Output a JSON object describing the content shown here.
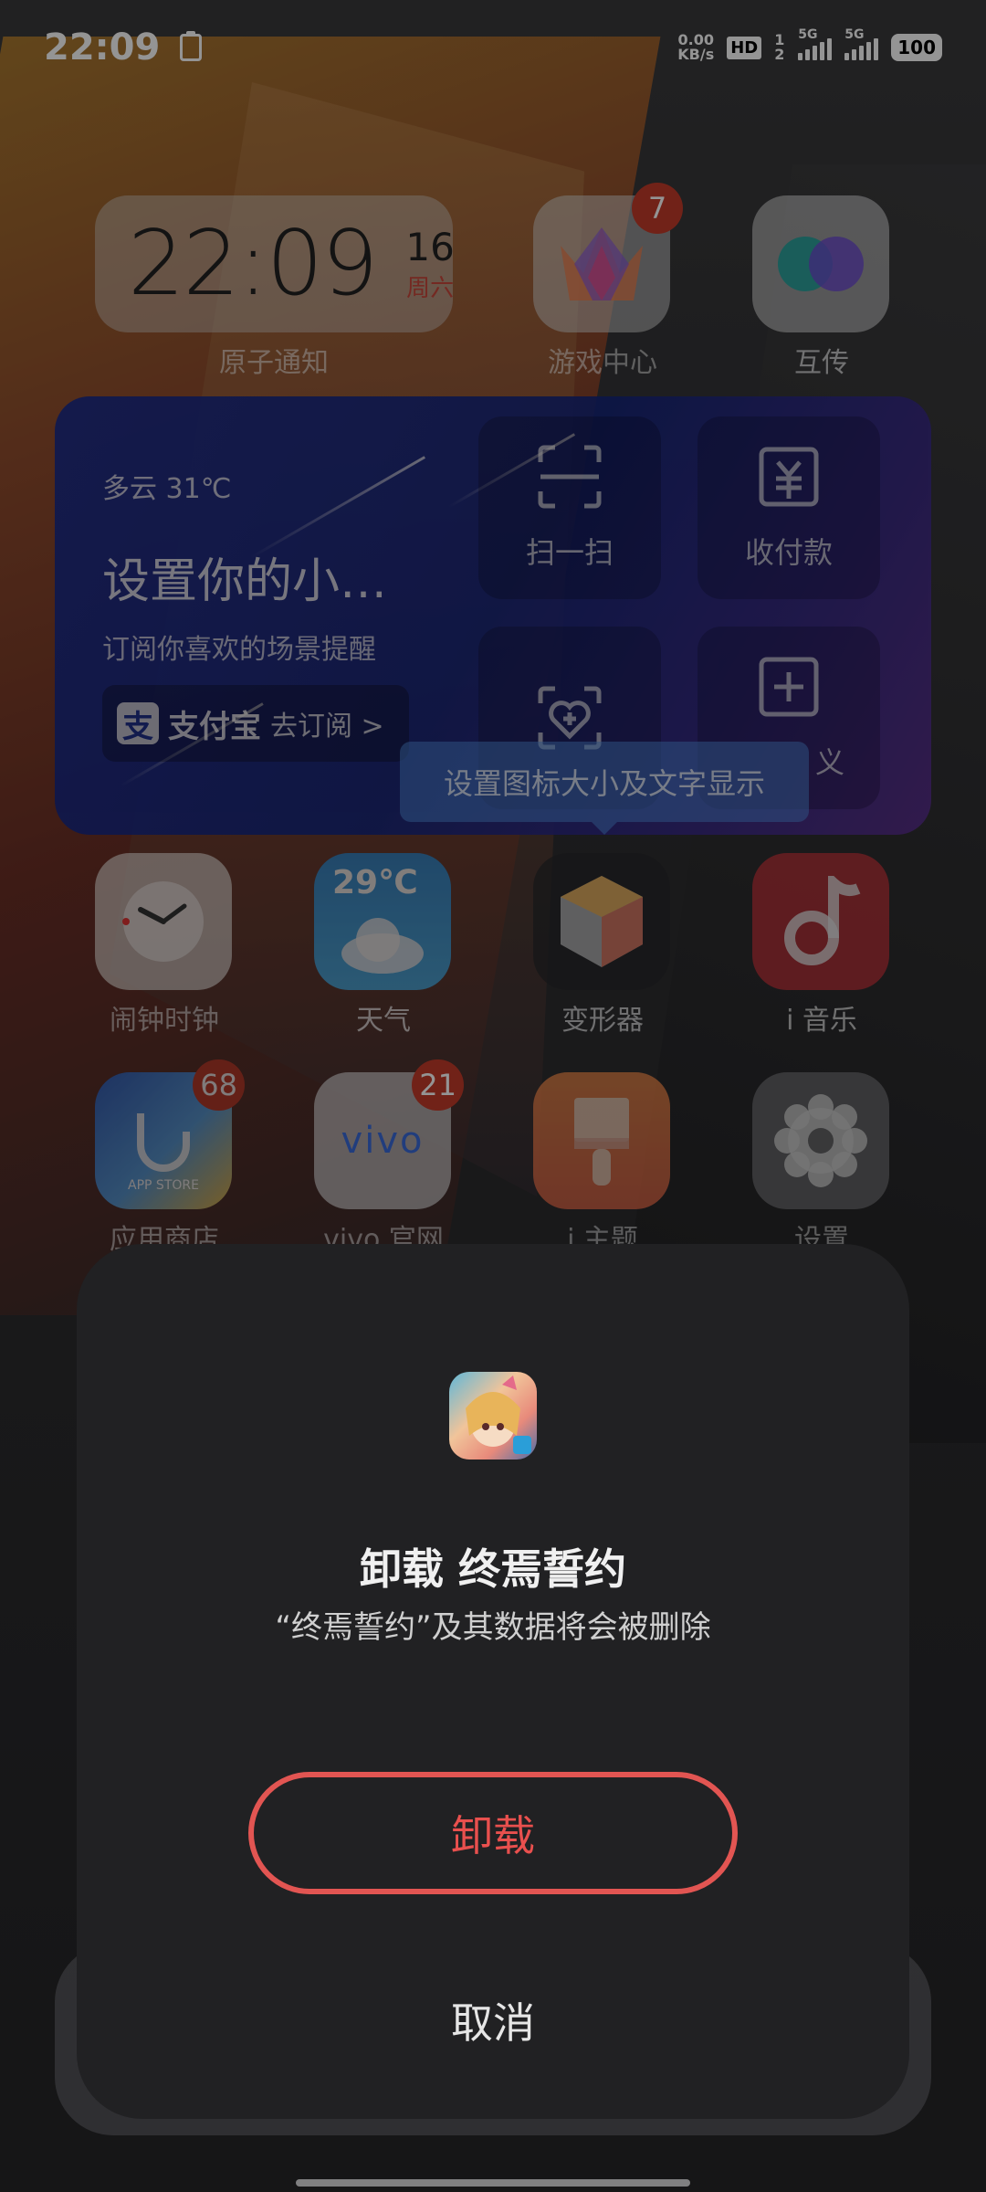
{
  "status_bar": {
    "time": "22:09",
    "net_speed_value": "0.00",
    "net_speed_unit": "KB/s",
    "hd": "HD",
    "sim1_label": "5G",
    "sim2_label": "5G",
    "sim_slot": "1 2",
    "battery": "100"
  },
  "home": {
    "clock_widget": {
      "time": "22:09",
      "day": "16",
      "weekday": "周六",
      "label": "原子通知"
    },
    "apps_row1": [
      {
        "label": "游戏中心",
        "badge": "7"
      },
      {
        "label": "互传"
      }
    ],
    "alipay_widget": {
      "weather": "多云 31℃",
      "title": "设置你的小…",
      "subtitle": "订阅你喜欢的场景提醒",
      "brand_logo": "支",
      "brand": "支付宝",
      "subscribe": "去订阅 >",
      "tiles": [
        {
          "label": "扫一扫",
          "icon": "scan-icon"
        },
        {
          "label": "收付款",
          "icon": "payment-icon"
        },
        {
          "label": "",
          "icon": "health-code-icon"
        },
        {
          "label": "义",
          "icon": "add-icon"
        }
      ]
    },
    "tooltip": "设置图标大小及文字显示",
    "apps_row2": [
      {
        "label": "闹钟时钟"
      },
      {
        "label": "天气",
        "temp": "29℃"
      },
      {
        "label": "变形器"
      },
      {
        "label": "i 音乐"
      }
    ],
    "apps_row3": [
      {
        "label": "应用商店",
        "badge": "68",
        "icon_text": "APP STORE"
      },
      {
        "label": "vivo 官网",
        "badge": "21",
        "icon_text": "vivo"
      },
      {
        "label": "i 主题"
      },
      {
        "label": "设置"
      }
    ]
  },
  "dialog": {
    "title": "卸载 终焉誓约",
    "description": "“终焉誓约”及其数据将会被删除",
    "uninstall": "卸载",
    "cancel": "取消"
  }
}
